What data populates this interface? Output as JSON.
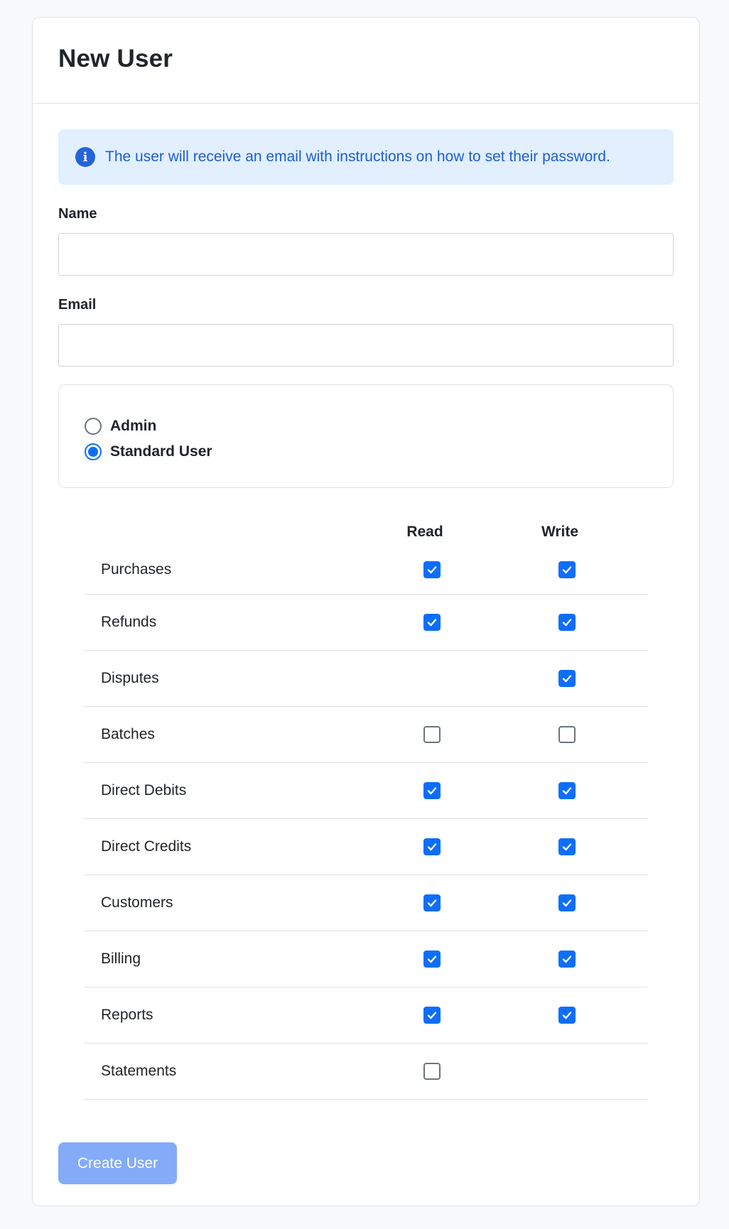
{
  "header": {
    "title": "New User"
  },
  "alert": {
    "icon": "info-icon",
    "message": "The user will receive an email with instructions on how to set their password."
  },
  "form": {
    "name_label": "Name",
    "name_value": "",
    "email_label": "Email",
    "email_value": ""
  },
  "roles": {
    "options": [
      {
        "label": "Admin",
        "selected": false
      },
      {
        "label": "Standard User",
        "selected": true
      }
    ]
  },
  "permissions": {
    "headers": {
      "read": "Read",
      "write": "Write"
    },
    "rows": [
      {
        "name": "Purchases",
        "read": true,
        "write": true
      },
      {
        "name": "Refunds",
        "read": true,
        "write": true
      },
      {
        "name": "Disputes",
        "read": null,
        "write": true
      },
      {
        "name": "Batches",
        "read": false,
        "write": false
      },
      {
        "name": "Direct Debits",
        "read": true,
        "write": true
      },
      {
        "name": "Direct Credits",
        "read": true,
        "write": true
      },
      {
        "name": "Customers",
        "read": true,
        "write": true
      },
      {
        "name": "Billing",
        "read": true,
        "write": true
      },
      {
        "name": "Reports",
        "read": true,
        "write": true
      },
      {
        "name": "Statements",
        "read": false,
        "write": null
      }
    ]
  },
  "actions": {
    "create_label": "Create User",
    "create_disabled": true
  },
  "colors": {
    "accent": "#0d6efd",
    "alert_bg": "#e1efff",
    "alert_text": "#1f5ecf",
    "button_disabled": "#84abf8"
  }
}
